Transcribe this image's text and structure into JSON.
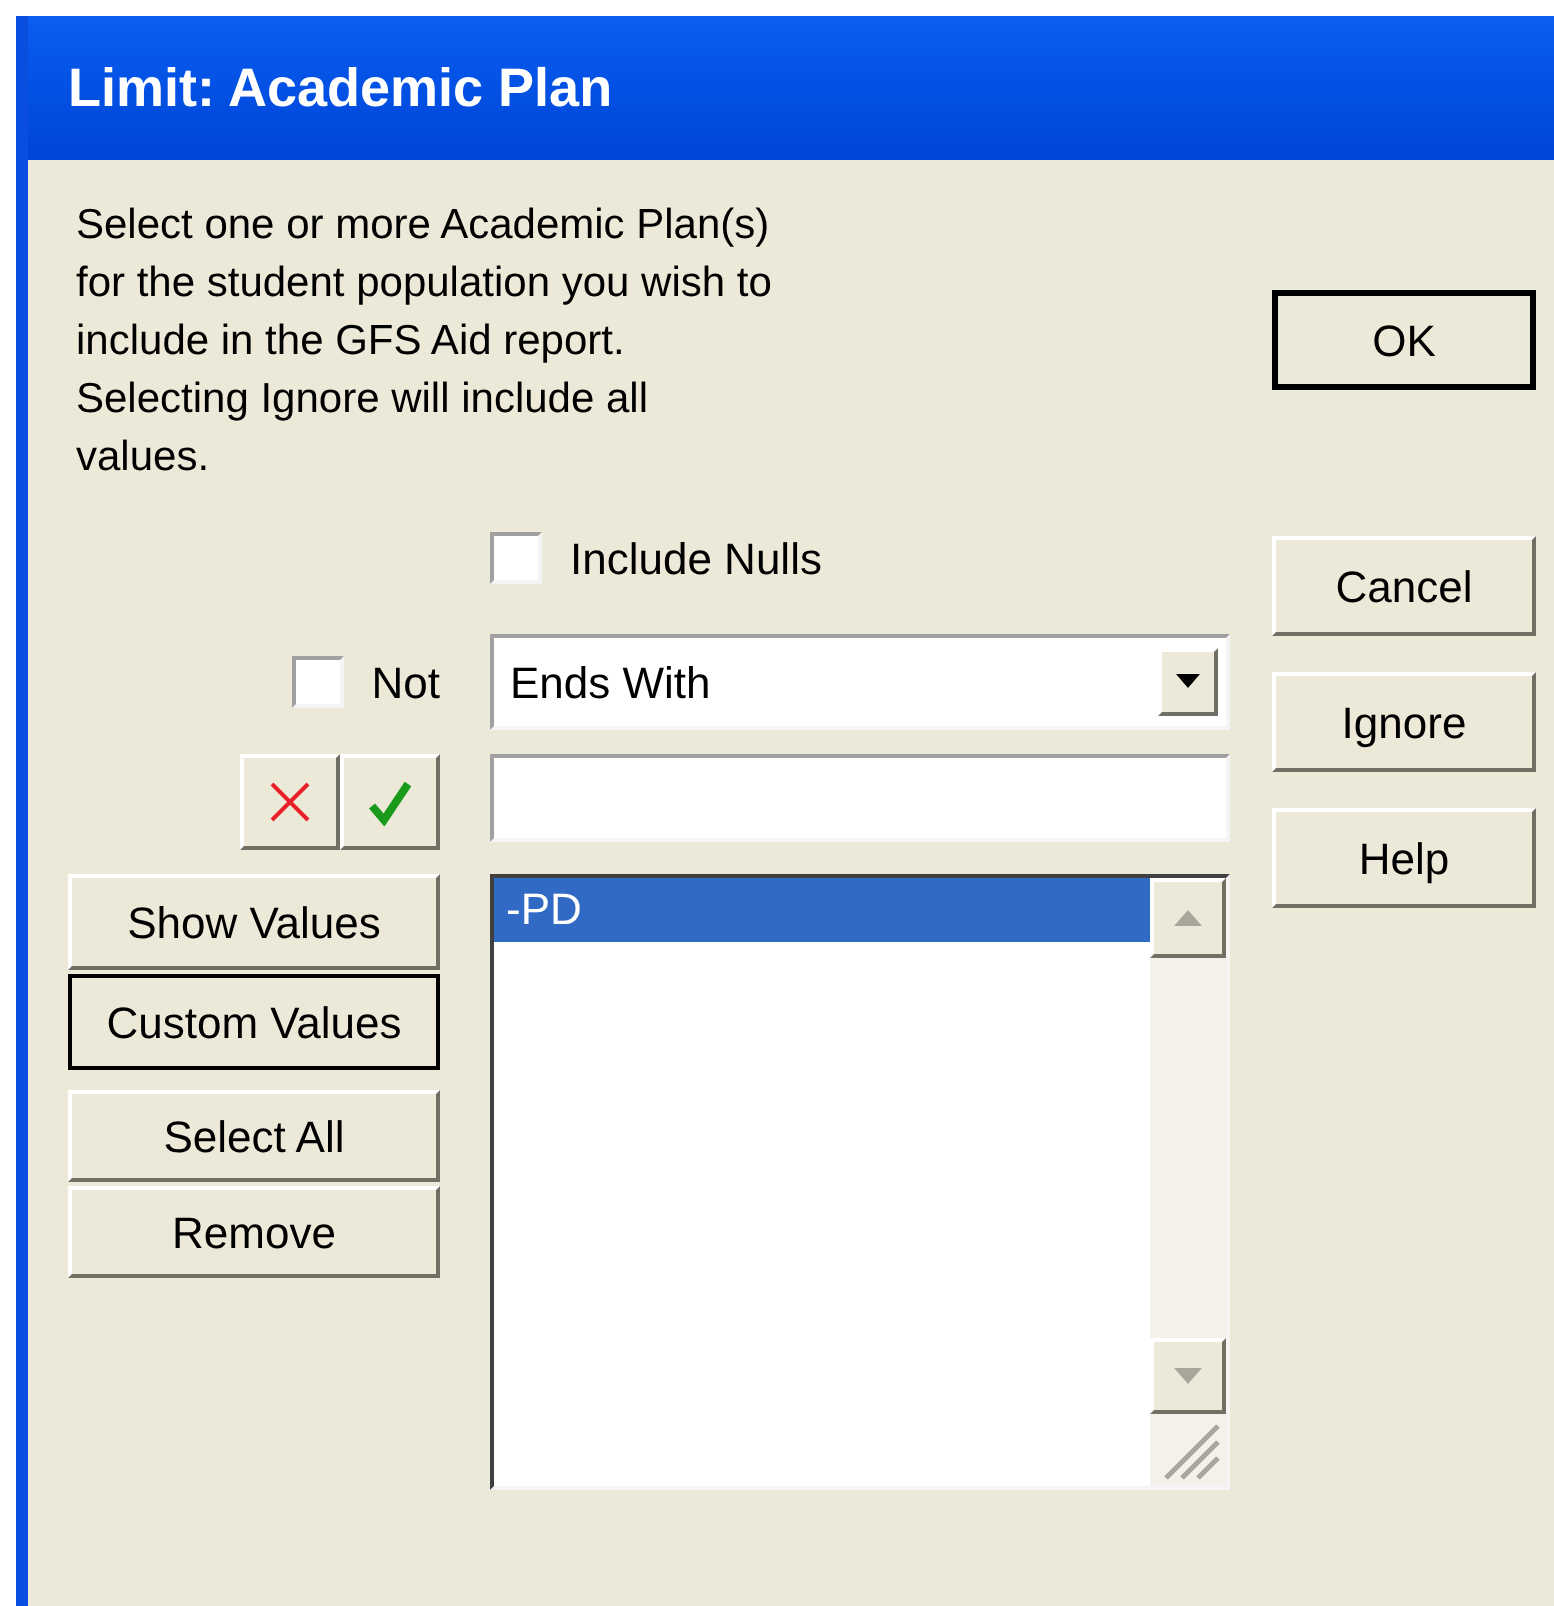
{
  "window": {
    "title": "Limit: Academic Plan"
  },
  "description": "Select one or more Academic Plan(s) for the student population you wish to include in the GFS Aid report.  Selecting Ignore will include all values.",
  "include_nulls": {
    "label": "Include Nulls",
    "checked": false
  },
  "not": {
    "label": "Not",
    "checked": false
  },
  "operator": {
    "value": "Ends With"
  },
  "mode_buttons": [
    {
      "label": "Show Values",
      "selected": false
    },
    {
      "label": "Custom Values",
      "selected": true
    }
  ],
  "action_buttons": [
    "Select All",
    "Remove"
  ],
  "values_list": [
    {
      "text": "-PD",
      "selected": true
    }
  ],
  "dialog_buttons": [
    {
      "label": "OK",
      "default": true
    },
    {
      "label": "Cancel",
      "default": false
    },
    {
      "label": "Ignore",
      "default": false
    },
    {
      "label": "Help",
      "default": false
    }
  ]
}
